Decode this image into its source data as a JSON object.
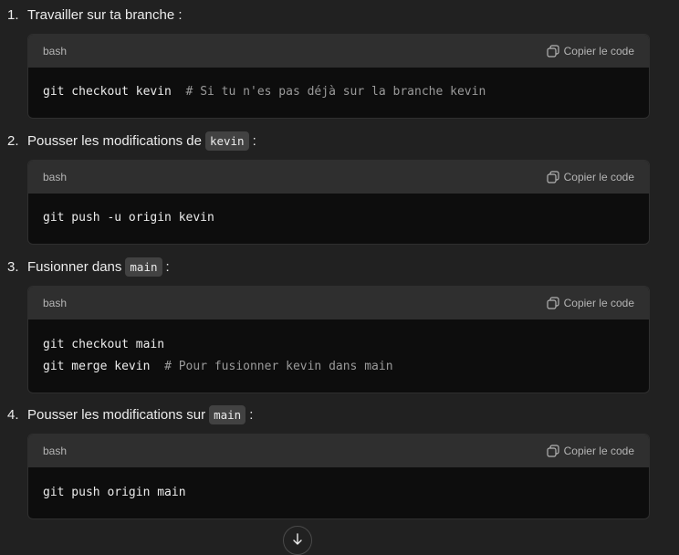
{
  "steps": [
    {
      "number": "1.",
      "text_before": "Travailler sur ta branche :",
      "inline_code": "",
      "text_after": "",
      "language": "bash",
      "copy_label": "Copier le code",
      "lines": [
        {
          "code": "git checkout kevin  ",
          "comment": "# Si tu n'es pas déjà sur la branche kevin"
        }
      ]
    },
    {
      "number": "2.",
      "text_before": "Pousser les modifications de",
      "inline_code": "kevin",
      "text_after": ":",
      "language": "bash",
      "copy_label": "Copier le code",
      "lines": [
        {
          "code": "git push -u origin kevin",
          "comment": ""
        }
      ]
    },
    {
      "number": "3.",
      "text_before": "Fusionner dans",
      "inline_code": "main",
      "text_after": ":",
      "language": "bash",
      "copy_label": "Copier le code",
      "lines": [
        {
          "code": "git checkout main",
          "comment": ""
        },
        {
          "code": "git merge kevin  ",
          "comment": "# Pour fusionner kevin dans main"
        }
      ]
    },
    {
      "number": "4.",
      "text_before": "Pousser les modifications sur",
      "inline_code": "main",
      "text_after": ":",
      "language": "bash",
      "copy_label": "Copier le code",
      "lines": [
        {
          "code": "git push origin main",
          "comment": ""
        }
      ]
    }
  ],
  "icons": {
    "copy": "copy-icon",
    "scroll_down": "arrow-down-icon"
  }
}
